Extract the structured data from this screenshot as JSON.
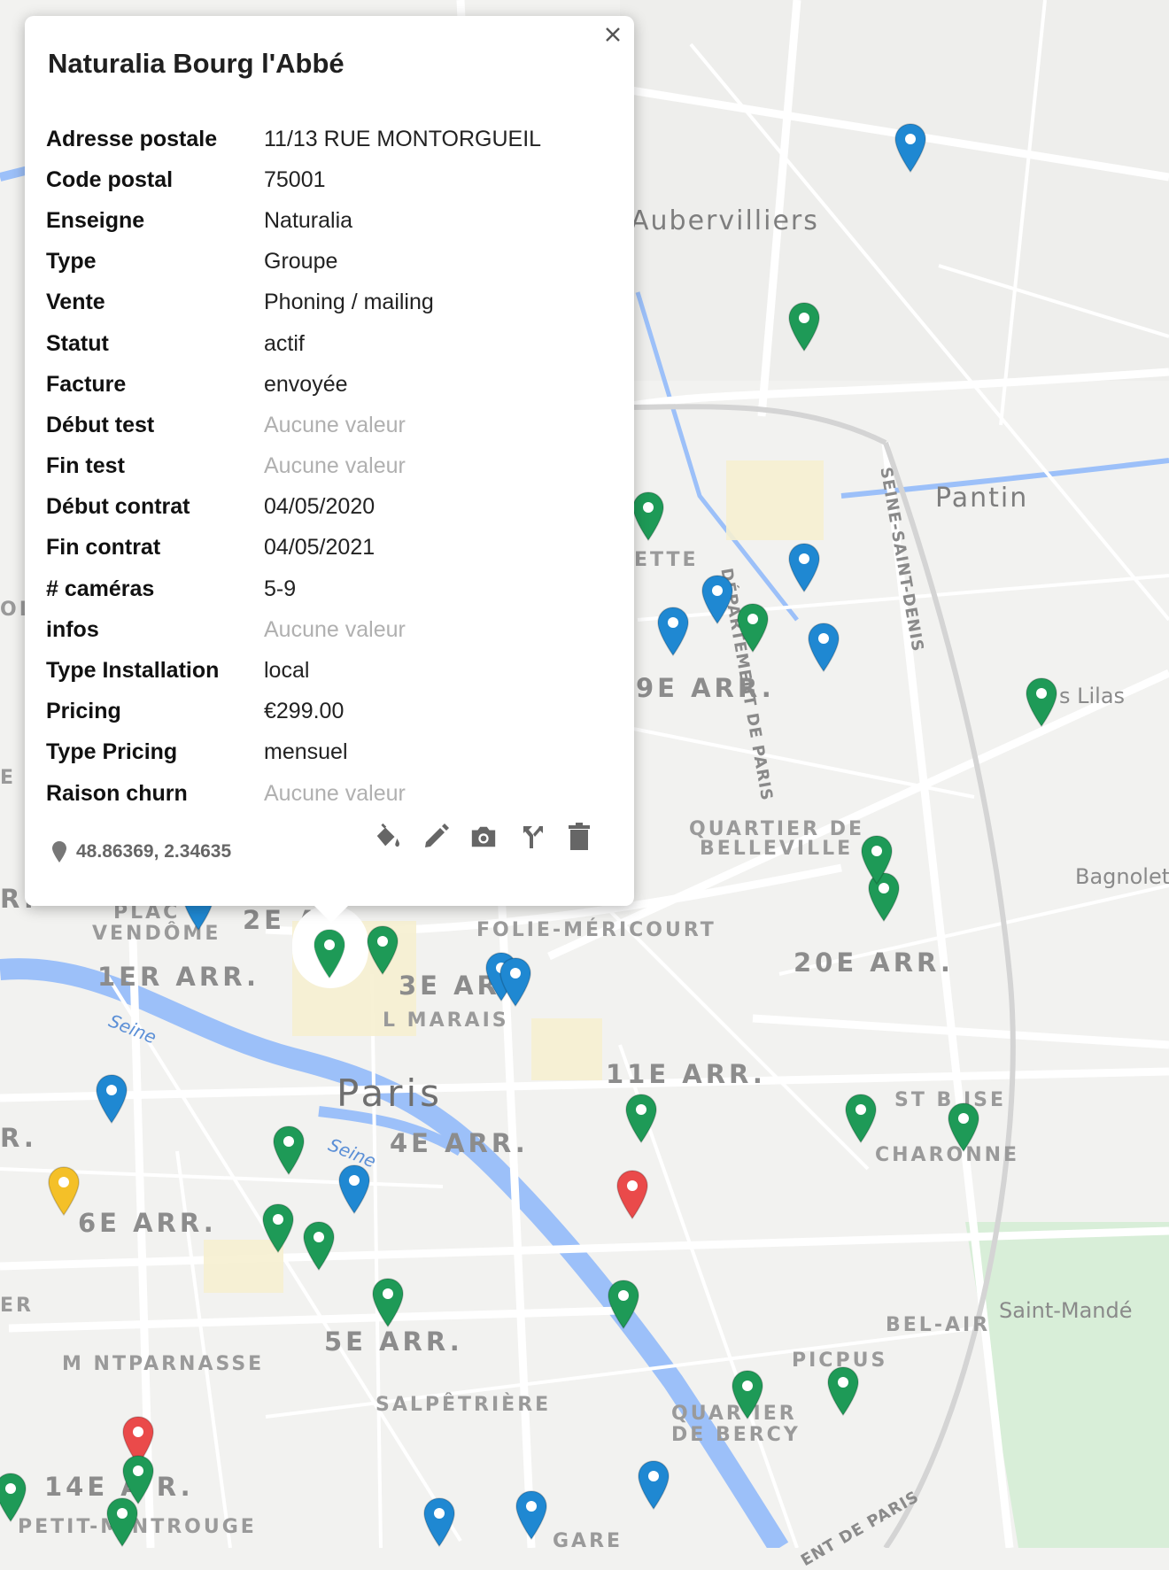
{
  "popup": {
    "title": "Naturalia Bourg l'Abbé",
    "close_label": "×",
    "coords": "48.86369, 2.34635",
    "rows": [
      {
        "label": "Adresse postale",
        "value": "11/13 RUE MONTORGUEIL",
        "empty": false
      },
      {
        "label": "Code postal",
        "value": "75001",
        "empty": false
      },
      {
        "label": "Enseigne",
        "value": "Naturalia",
        "empty": false
      },
      {
        "label": "Type",
        "value": "Groupe",
        "empty": false
      },
      {
        "label": "Vente",
        "value": "Phoning / mailing",
        "empty": false
      },
      {
        "label": "Statut",
        "value": "actif",
        "empty": false
      },
      {
        "label": "Facture",
        "value": "envoyée",
        "empty": false
      },
      {
        "label": "Début test",
        "value": "Aucune valeur",
        "empty": true
      },
      {
        "label": "Fin test",
        "value": "Aucune valeur",
        "empty": true
      },
      {
        "label": "Début contrat",
        "value": "04/05/2020",
        "empty": false
      },
      {
        "label": "Fin contrat",
        "value": "04/05/2021",
        "empty": false
      },
      {
        "label": "# caméras",
        "value": "5-9",
        "empty": false
      },
      {
        "label": "infos",
        "value": "Aucune valeur",
        "empty": true
      },
      {
        "label": "Type Installation",
        "value": "local",
        "empty": false
      },
      {
        "label": "Pricing",
        "value": "€299.00",
        "empty": false
      },
      {
        "label": "Type Pricing",
        "value": "mensuel",
        "empty": false
      },
      {
        "label": "Raison churn",
        "value": "Aucune valeur",
        "empty": true
      }
    ],
    "tools": [
      "paint-bucket-icon",
      "pencil-icon",
      "camera-icon",
      "split-icon",
      "trash-icon"
    ]
  },
  "map": {
    "labels": {
      "aubervilliers": "Aubervilliers",
      "pantin": "Pantin",
      "lilas": "s Lilas",
      "bagnolet": "Bagnolet",
      "saint_mande": "Saint-Mandé",
      "paris": "Paris",
      "arr19": "9E ARR.",
      "arr20": "20E ARR.",
      "arr11": "11E ARR.",
      "arr1": "1ER ARR.",
      "arr2": "2E A",
      "arr3": "3E AR",
      "arr4": "4E ARR.",
      "arr5": "5E ARR.",
      "arr6": "6E ARR.",
      "arr14": "14E A    R.",
      "belleville": "QUARTIER DE",
      "belleville2": "BELLEVILLE",
      "folie": "FOLIE-MÉRICOURT",
      "marais": "L    MARAIS",
      "vendome": "PLAC",
      "vendome2": "VENDÔME",
      "st_blaise": "ST B     ISE",
      "charonne": "CHARONNE",
      "bel_air": "BEL-AIR",
      "picpus": "PICPUS",
      "bercy": "QUAR     IER",
      "bercy2": "DE BERCY",
      "salpetriere": "SALPÊTRIÈRE",
      "montparnasse": "M    NTPARNASSE",
      "petit_montrouge": "PETIT-M    NTROUGE",
      "gare": "GARE",
      "villette": "ETTE",
      "seine1": "Seine",
      "seine2": "Seine",
      "dept_paris": "DÉPARTEMENT DE PARIS",
      "ssd": "SEINE-SAINT-DENIS",
      "ent_paris": "ENT DE PARIS",
      "edge_arr": "R.",
      "edge_r": "R.",
      "edge_er": "ER",
      "edge_ol": "OL",
      "edge_e": "E"
    },
    "colors": {
      "green": "#1e9a57",
      "blue": "#1f88d2",
      "red": "#ea4a4a",
      "yellow": "#f4c028",
      "water": "#9cc0f9",
      "road": "#ffffff"
    },
    "markers": [
      {
        "color": "blue"
      },
      {
        "color": "green"
      },
      {
        "color": "green"
      },
      {
        "color": "blue"
      },
      {
        "color": "blue"
      },
      {
        "color": "blue"
      },
      {
        "color": "green"
      },
      {
        "color": "blue"
      },
      {
        "color": "green"
      },
      {
        "color": "green"
      },
      {
        "color": "green"
      },
      {
        "color": "blue"
      },
      {
        "color": "green"
      },
      {
        "color": "green"
      },
      {
        "color": "blue"
      },
      {
        "color": "blue"
      },
      {
        "color": "green"
      },
      {
        "color": "green"
      },
      {
        "color": "blue"
      },
      {
        "color": "yellow"
      },
      {
        "color": "green"
      },
      {
        "color": "green"
      },
      {
        "color": "red"
      },
      {
        "color": "green"
      },
      {
        "color": "green"
      },
      {
        "color": "blue"
      },
      {
        "color": "green"
      },
      {
        "color": "green"
      },
      {
        "color": "green"
      },
      {
        "color": "blue"
      },
      {
        "color": "red"
      },
      {
        "color": "green"
      },
      {
        "color": "green"
      },
      {
        "color": "green"
      },
      {
        "color": "blue"
      },
      {
        "color": "blue"
      },
      {
        "color": "green"
      }
    ]
  }
}
